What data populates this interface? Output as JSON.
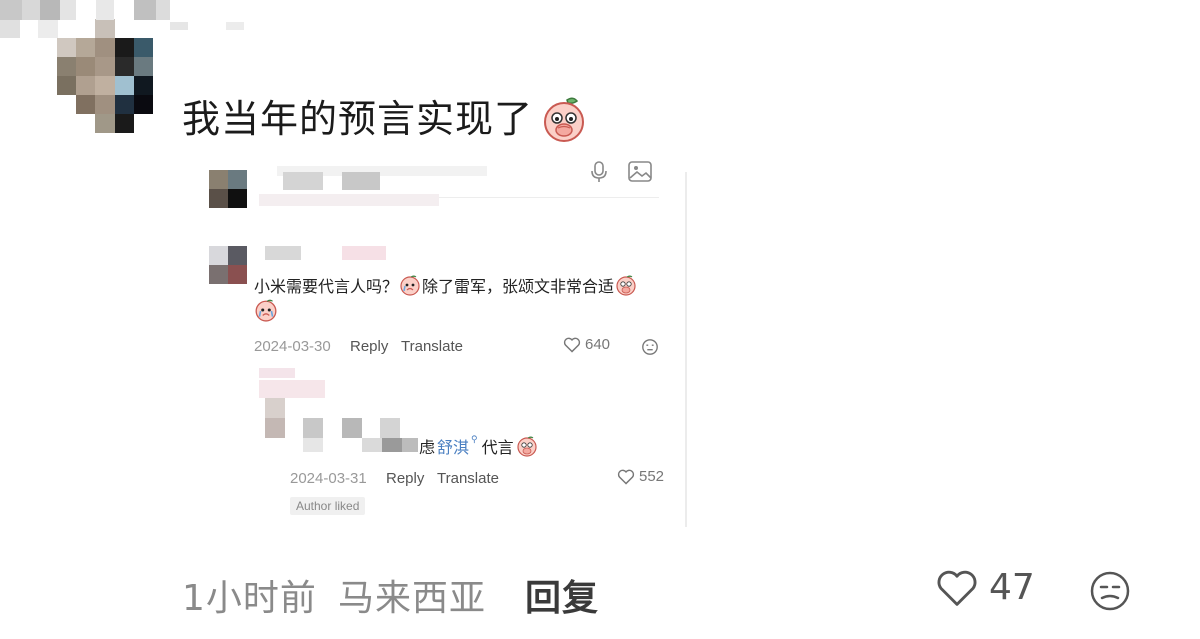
{
  "comment": {
    "text": "我当年的预言实现了",
    "emoji_icon": "peach-cover-mouth-emoji"
  },
  "embedded": {
    "top_comment": {
      "text": "小米需要代言人吗？",
      "text2": "除了雷军，张颂文非常合适",
      "date": "2024-03-30",
      "reply_label": "Reply",
      "translate_label": "Translate",
      "likes": "640"
    },
    "reply_comment": {
      "text_tail": "虑",
      "name_highlight": "舒淇",
      "text_end": "代言",
      "date": "2024-03-31",
      "reply_label": "Reply",
      "translate_label": "Translate",
      "likes": "552",
      "badge": "Author liked"
    }
  },
  "footer": {
    "time": "1小时前",
    "location": "马来西亚",
    "reply_label": "回复",
    "likes": "47"
  },
  "colors": {
    "text_primary": "#1b1b1b",
    "text_muted": "#8a8a8a",
    "highlight_blue": "#4a7fc1"
  }
}
